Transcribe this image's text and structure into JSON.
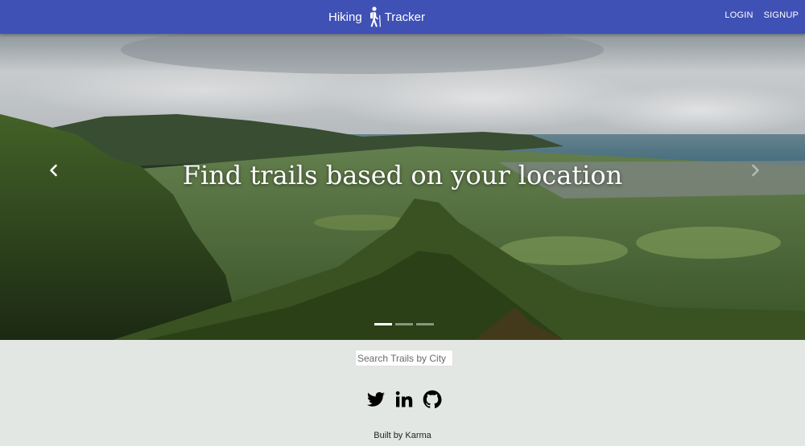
{
  "navbar": {
    "brand_left": "Hiking",
    "brand_right": "Tracker",
    "brand_icon": "hiker-icon",
    "login_label": "LOGIN",
    "signup_label": "SIGNUP",
    "bg_color": "#3f51b5"
  },
  "carousel": {
    "caption": "Find trails based on your location",
    "slide_count": 3,
    "active_slide": 1,
    "prev_icon": "chevron-left-icon",
    "next_icon": "chevron-right-icon"
  },
  "search": {
    "placeholder": "Search Trails by City",
    "value": ""
  },
  "socials": {
    "icons": [
      "twitter-icon",
      "linkedin-icon",
      "github-icon"
    ]
  },
  "footer": {
    "credit": "Built by Karma"
  }
}
